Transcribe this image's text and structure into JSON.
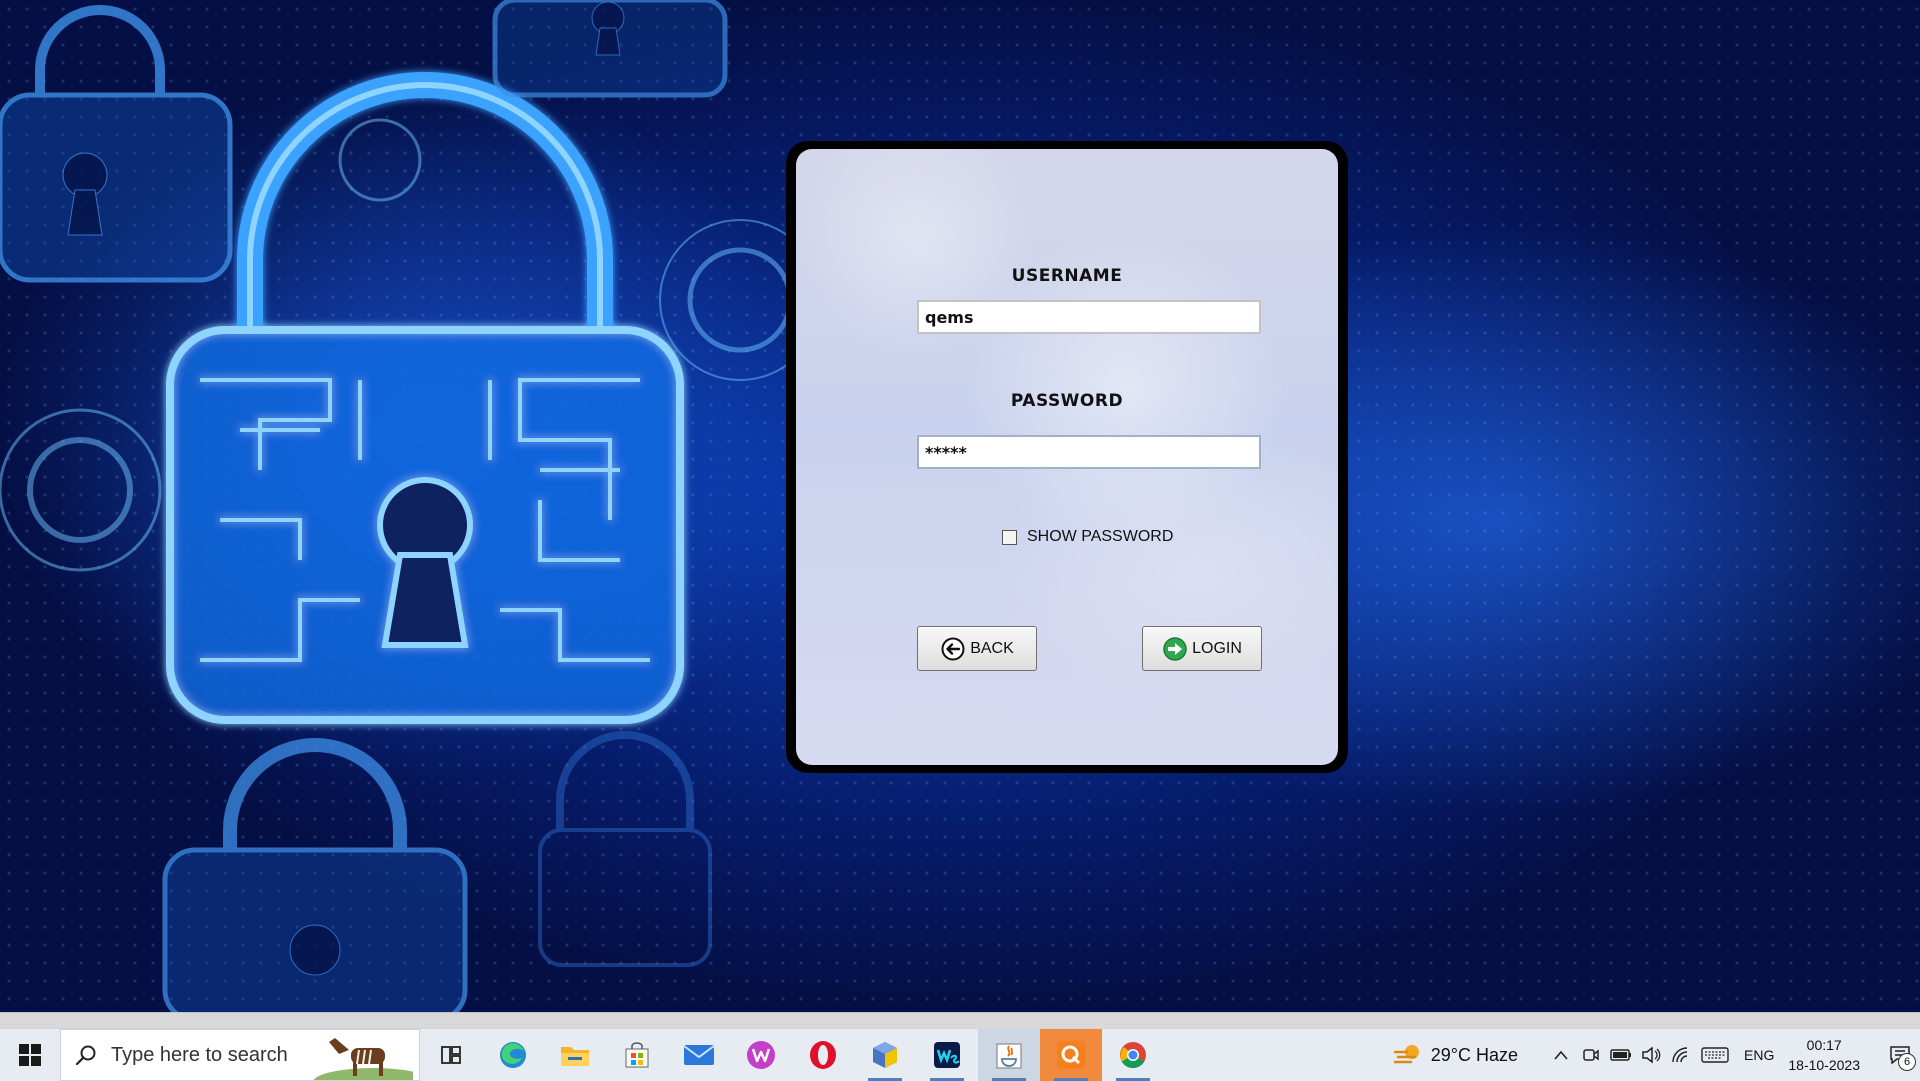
{
  "login_form": {
    "username_label": "USERNAME",
    "username_value": "qems",
    "password_label": "PASSWORD",
    "password_value": "*****",
    "show_password_label": "SHOW PASSWORD",
    "show_password_checked": false,
    "back_label": "BACK",
    "login_label": "LOGIN"
  },
  "taskbar": {
    "search_placeholder": "Type here to search",
    "apps": [
      {
        "name": "task-view-icon"
      },
      {
        "name": "edge-icon"
      },
      {
        "name": "file-explorer-icon"
      },
      {
        "name": "microsoft-store-icon"
      },
      {
        "name": "mail-icon"
      },
      {
        "name": "wps-office-icon"
      },
      {
        "name": "opera-icon"
      },
      {
        "name": "virtualbox-icon"
      },
      {
        "name": "webstorm-icon"
      },
      {
        "name": "java-icon"
      },
      {
        "name": "qutebrowser-icon"
      },
      {
        "name": "chrome-icon"
      }
    ],
    "weather_text": "29°C  Haze",
    "language": "ENG",
    "time": "00:17",
    "date": "18-10-2023",
    "notification_count": "6"
  },
  "colors": {
    "background_blue": "#0b3fb8",
    "panel": "#d4d7ea",
    "login_icon_green": "#2fa84f",
    "taskbar": "#e7ecf3"
  }
}
